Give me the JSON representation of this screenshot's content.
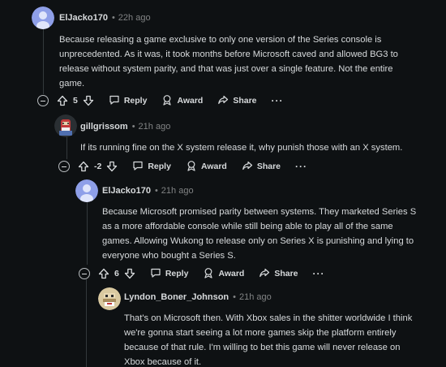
{
  "comments": [
    {
      "author": "ElJacko170",
      "time": "22h ago",
      "body": "Because releasing a game exclusive to only one version of the Series console is\nunprecedented. As it was, it took months before Microsoft caved and allowed BG3 to\nrelease without system parity, and that was just over a single feature. Not the entire\ngame.",
      "score": "5",
      "reply_label": "Reply",
      "award_label": "Award",
      "share_label": "Share",
      "more_label": "···",
      "avatar_color": "#8e9fe8"
    },
    {
      "author": "gillgrissom",
      "time": "21h ago",
      "body": "If its running fine on the X system release it, why punish those with an X system.",
      "score": "-2",
      "reply_label": "Reply",
      "award_label": "Award",
      "share_label": "Share",
      "more_label": "···",
      "avatar_color": "#c23b3b"
    },
    {
      "author": "ElJacko170",
      "time": "21h ago",
      "body": "Because Microsoft promised parity between systems. They marketed Series S\nas a more affordable console while still being able to play all of the same\ngames. Allowing Wukong to release only on Series X is punishing and lying to\neveryone who bought a Series S.",
      "score": "6",
      "reply_label": "Reply",
      "award_label": "Award",
      "share_label": "Share",
      "more_label": "···",
      "avatar_color": "#8e9fe8"
    },
    {
      "author": "Lyndon_Boner_Johnson",
      "time": "21h ago",
      "body": "That's on Microsoft then. With Xbox sales in the shitter worldwide I think\nwe're gonna start seeing a lot more games skip the platform entirely\nbecause of that rule. I'm willing to bet this game will never release on\nXbox because of it.",
      "avatar_color": "#d9c9a0"
    }
  ],
  "separator": "•"
}
